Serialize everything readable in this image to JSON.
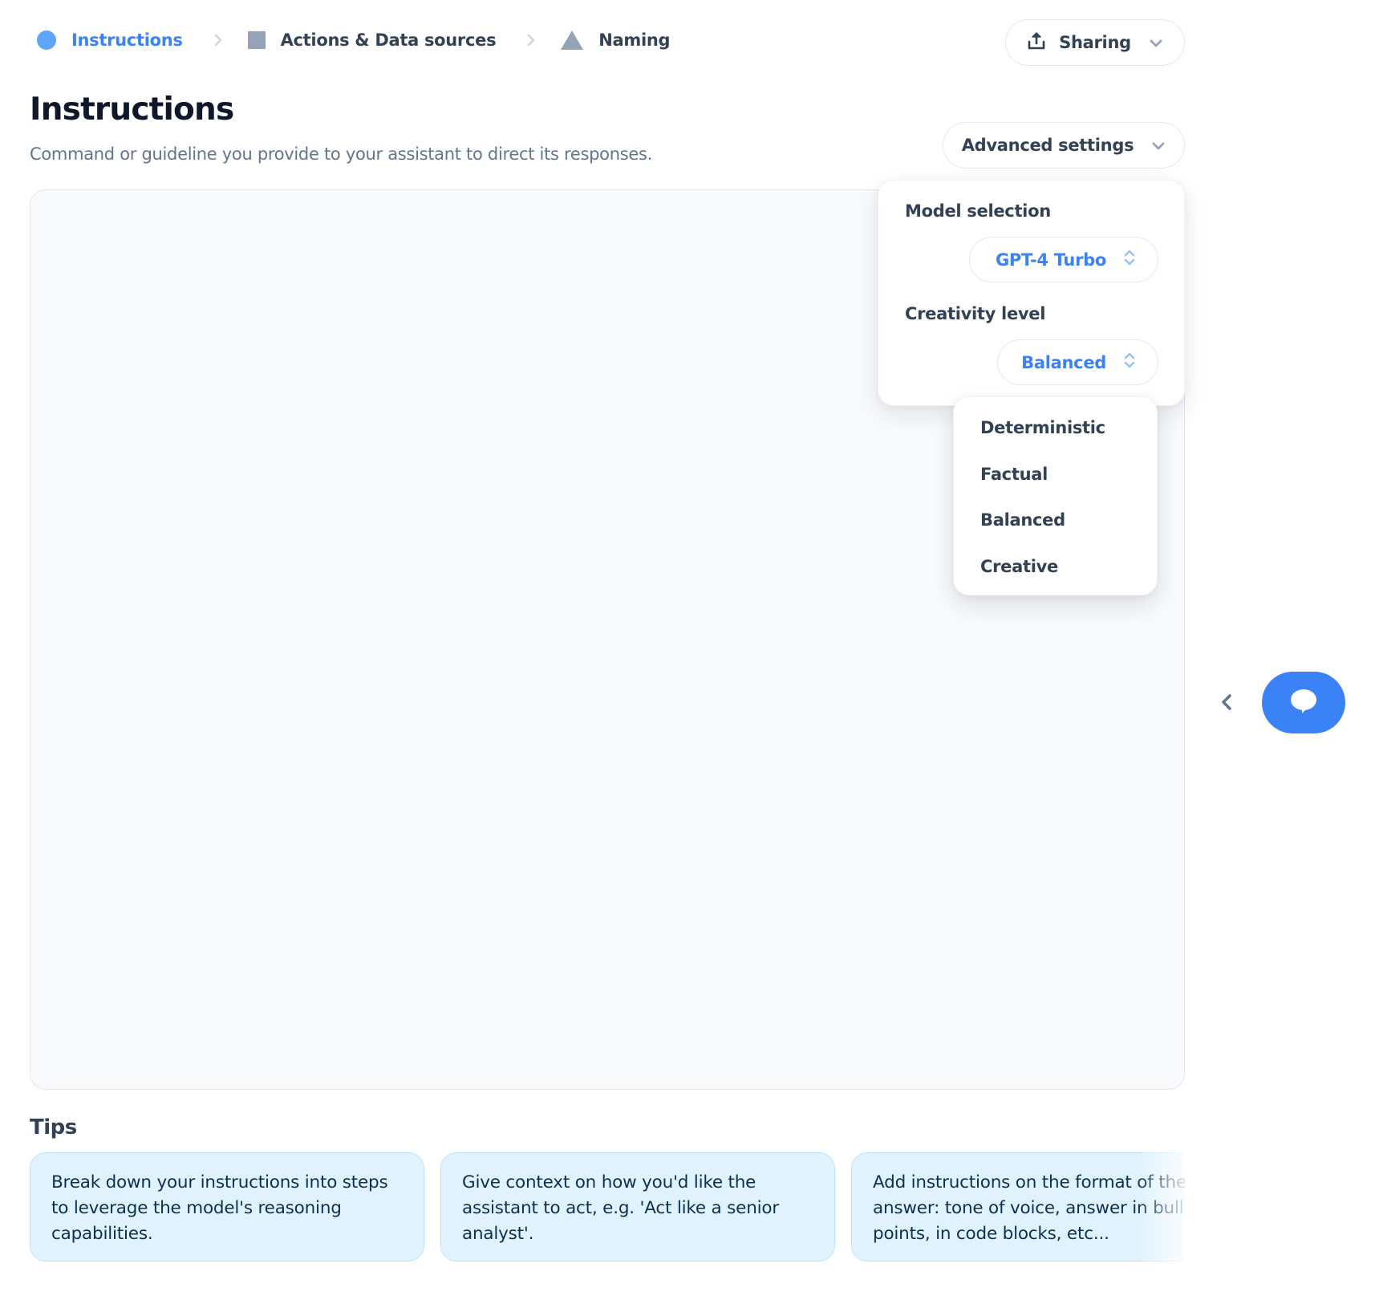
{
  "breadcrumb": {
    "steps": [
      {
        "label": "Instructions",
        "icon": "circle-icon",
        "active": true
      },
      {
        "label": "Actions & Data sources",
        "icon": "square-icon",
        "active": false
      },
      {
        "label": "Naming",
        "icon": "triangle-icon",
        "active": false
      }
    ],
    "separator_icon": "chevron-right-icon"
  },
  "header": {
    "sharing_label": "Sharing",
    "sharing_icon": "share-upload-icon",
    "title": "Instructions",
    "subtitle": "Command or guideline you provide to your assistant to direct its responses.",
    "advanced_settings_label": "Advanced settings"
  },
  "editor": {
    "value": "",
    "placeholder": ""
  },
  "advanced_settings": {
    "model_label": "Model selection",
    "model_value": "GPT-4 Turbo",
    "creativity_label": "Creativity level",
    "creativity_value": "Balanced",
    "creativity_options": [
      "Deterministic",
      "Factual",
      "Balanced",
      "Creative"
    ]
  },
  "tips": {
    "title": "Tips",
    "items": [
      "Break down your instructions into steps to leverage the model's reasoning capabilities.",
      "Give context on how you'd like the assistant to act, e.g. 'Act like a senior analyst'.",
      "Add instructions on the format of the answer: tone of voice, answer in bullet points, in code blocks, etc..."
    ]
  },
  "side": {
    "collapse_icon": "chevron-left-icon",
    "chat_icon": "chat-bubble-icon"
  },
  "colors": {
    "accent": "#3B82F6",
    "active_step": "#60A5FA",
    "inactive_step": "#94A3B8",
    "text_dark": "#334155",
    "tip_bg": "#E0F2FE",
    "editor_bg": "#F8FAFC"
  }
}
